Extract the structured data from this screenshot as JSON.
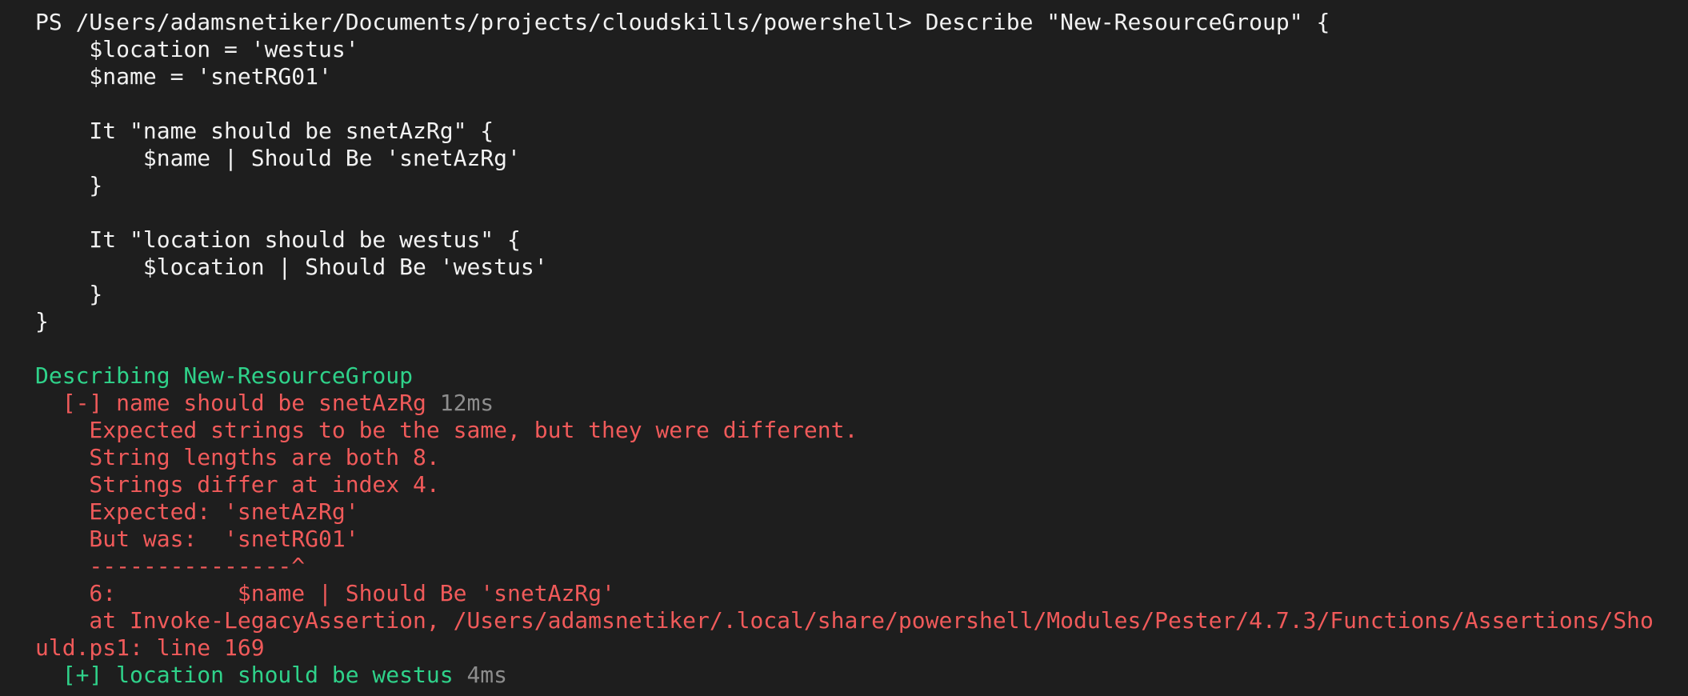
{
  "terminal": {
    "lines": [
      [
        {
          "t": "PS /Users/adamsnetiker/Documents/projects/cloudskills/powershell> Describe \"New-ResourceGroup\" {",
          "c": "white"
        }
      ],
      [
        {
          "t": "    $location = 'westus'",
          "c": "white"
        }
      ],
      [
        {
          "t": "    $name = 'snetRG01'",
          "c": "white"
        }
      ],
      [
        {
          "t": "",
          "c": "white"
        }
      ],
      [
        {
          "t": "    It \"name should be snetAzRg\" {",
          "c": "white"
        }
      ],
      [
        {
          "t": "        $name | Should Be 'snetAzRg'",
          "c": "white"
        }
      ],
      [
        {
          "t": "    }",
          "c": "white"
        }
      ],
      [
        {
          "t": "",
          "c": "white"
        }
      ],
      [
        {
          "t": "    It \"location should be westus\" {",
          "c": "white"
        }
      ],
      [
        {
          "t": "        $location | Should Be 'westus'",
          "c": "white"
        }
      ],
      [
        {
          "t": "    }",
          "c": "white"
        }
      ],
      [
        {
          "t": "}",
          "c": "white"
        }
      ],
      [
        {
          "t": "",
          "c": "white"
        }
      ],
      [
        {
          "t": "Describing New-ResourceGroup",
          "c": "green"
        }
      ],
      [
        {
          "t": "  [-] name should be snetAzRg ",
          "c": "red"
        },
        {
          "t": "12ms",
          "c": "gray"
        }
      ],
      [
        {
          "t": "    Expected strings to be the same, but they were different.",
          "c": "red"
        }
      ],
      [
        {
          "t": "    String lengths are both 8.",
          "c": "red"
        }
      ],
      [
        {
          "t": "    Strings differ at index 4.",
          "c": "red"
        }
      ],
      [
        {
          "t": "    Expected: 'snetAzRg'",
          "c": "red"
        }
      ],
      [
        {
          "t": "    But was:  'snetRG01'",
          "c": "red"
        }
      ],
      [
        {
          "t": "    ---------------^",
          "c": "red"
        }
      ],
      [
        {
          "t": "    6:         $name | Should Be 'snetAzRg'",
          "c": "red"
        }
      ],
      [
        {
          "t": "    at Invoke-LegacyAssertion, /Users/adamsnetiker/.local/share/powershell/Modules/Pester/4.7.3/Functions/Assertions/Sho",
          "c": "red"
        }
      ],
      [
        {
          "t": "uld.ps1: line 169",
          "c": "red"
        }
      ],
      [
        {
          "t": "  [+] location should be westus ",
          "c": "green"
        },
        {
          "t": "4ms",
          "c": "gray"
        }
      ],
      [
        {
          "t": "",
          "c": "white"
        }
      ]
    ]
  }
}
